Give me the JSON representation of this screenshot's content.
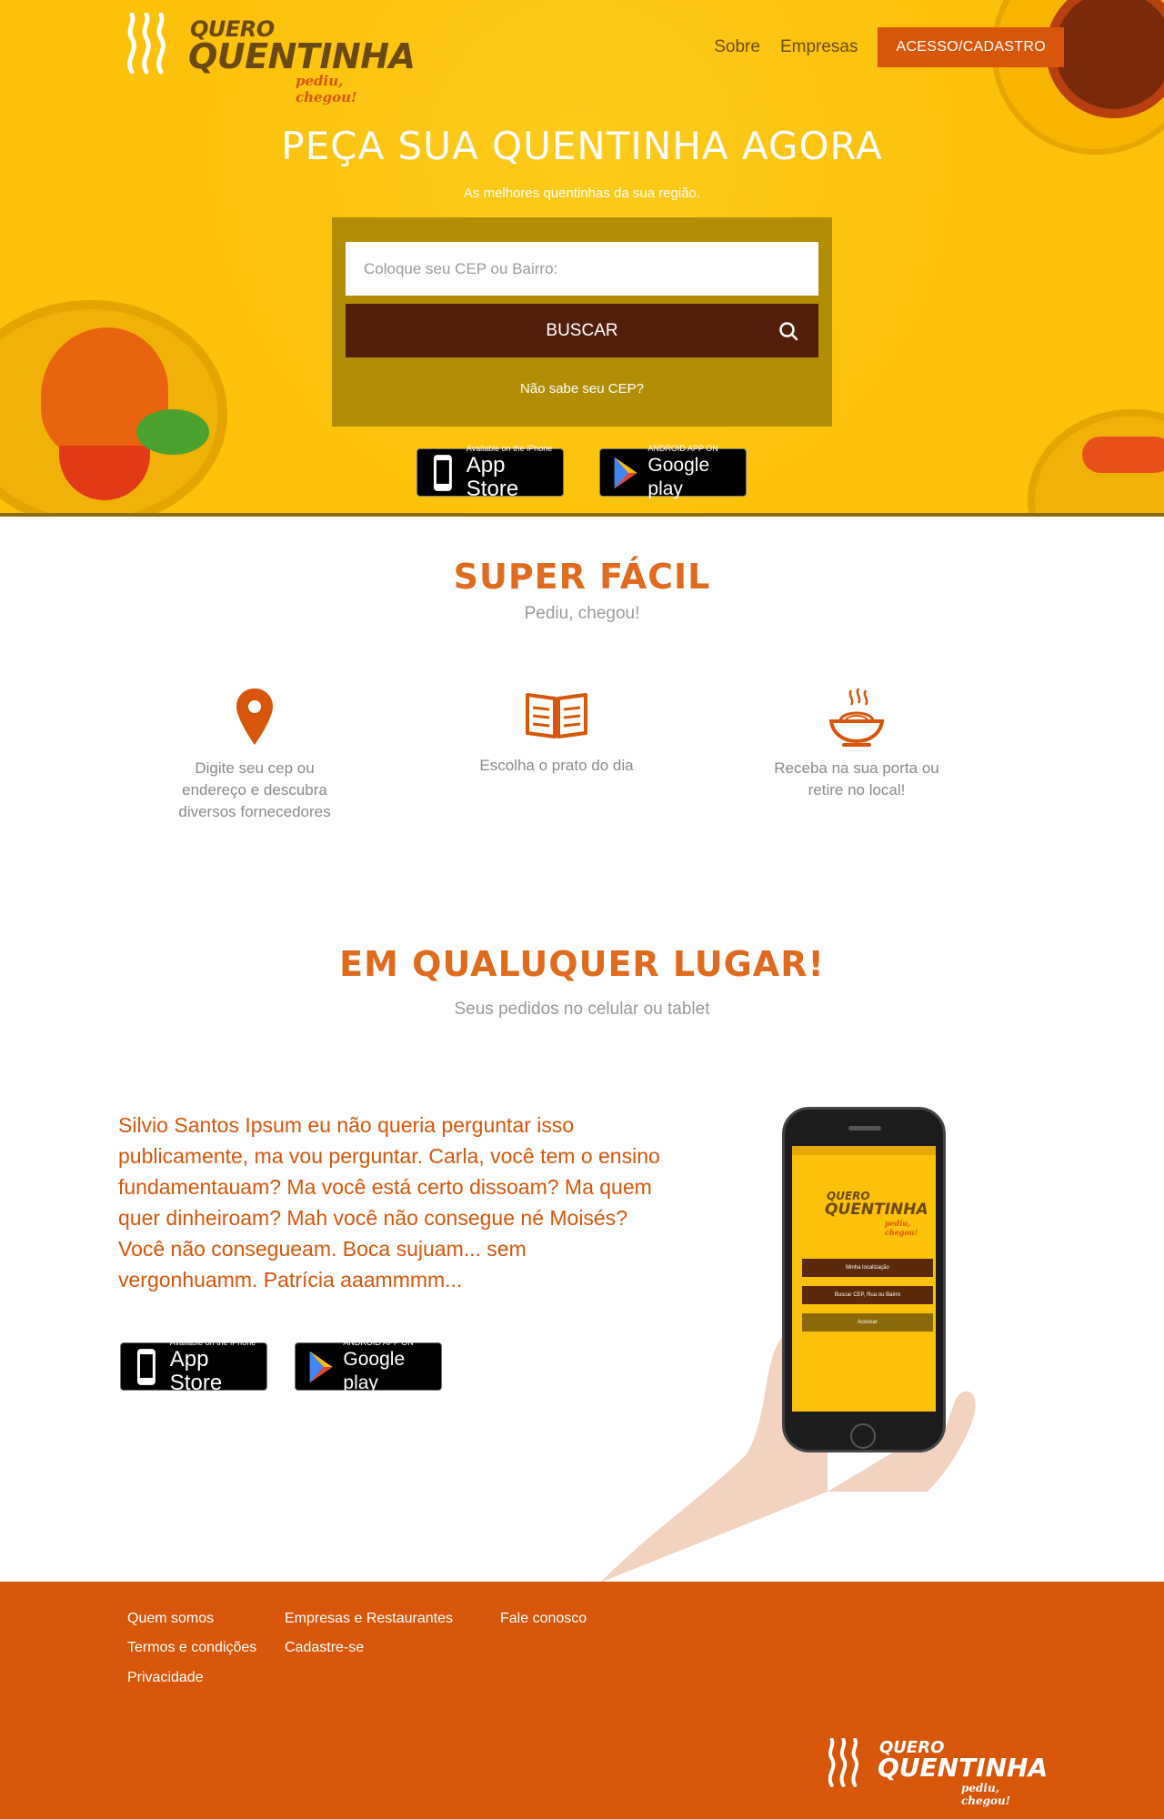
{
  "brand": {
    "line1": "QUERO",
    "line2": "QUENTINHA",
    "tagline": "pediu, chegou!"
  },
  "nav": {
    "links": [
      "Sobre",
      "Empresas"
    ],
    "cta": "ACESSO/CADASTRO"
  },
  "hero": {
    "title": "Peça sua quentinha agora",
    "subtitle": "As melhores quentinhas da sua região.",
    "search_placeholder": "Coloque seu CEP ou Bairro:",
    "search_button": "BUSCAR",
    "cep_link": "Não sabe seu CEP?"
  },
  "stores": {
    "appstore_small": "Available on the iPhone",
    "appstore_big": "App Store",
    "googleplay_small": "ANDROID APP ON",
    "googleplay_big": "Google play"
  },
  "easy": {
    "title": "Super fácil",
    "subtitle": "Pediu, chegou!",
    "features": [
      {
        "icon": "location-pin-icon",
        "text": "Digite seu cep ou endereço e descubra diversos fornecedores"
      },
      {
        "icon": "menu-book-icon",
        "text": "Escolha o prato do dia"
      },
      {
        "icon": "food-bowl-icon",
        "text": "Receba na sua porta ou retire no local!"
      }
    ]
  },
  "anywhere": {
    "title": "Em qualuquer lugar!",
    "subtitle": "Seus pedidos no celular ou tablet",
    "body": "Silvio Santos Ipsum eu não queria perguntar isso publicamente, ma vou perguntar. Carla, você tem o ensino fundamentauam? Ma você está certo dissoam? Ma quem quer dinheiroam? Mah você não consegue né Moisés? Você não consegueam. Boca sujuam... sem vergonhuamm. Patrícia aaammmm..."
  },
  "phone": {
    "row1": "Minha localização",
    "row2": "Buscar CEP, Rua ou Bairro",
    "row3": "Acessar"
  },
  "footer": {
    "col1": [
      "Quem somos",
      "Termos e condições",
      "Privacidade"
    ],
    "col2": [
      "Empresas e Restaurantes",
      "Cadastre-se"
    ],
    "col3": [
      "Fale conosco"
    ]
  },
  "colors": {
    "hero_bg": "#fcc10a",
    "accent": "#d8560a",
    "dark_brown": "#52200a",
    "search_panel": "#b28e06"
  }
}
